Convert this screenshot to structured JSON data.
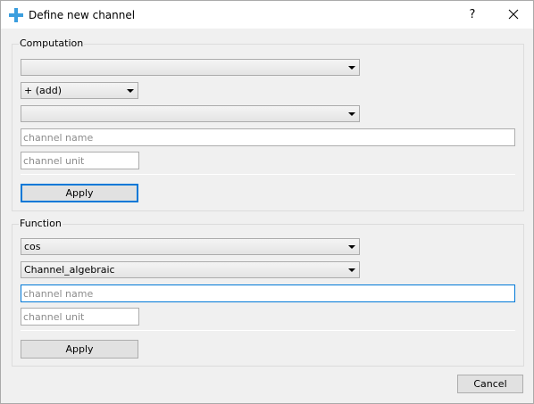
{
  "window": {
    "title": "Define new channel",
    "help_label": "?",
    "icons": {
      "app": "plus-icon",
      "close": "close-icon",
      "dropdown": "chevron-down-icon"
    }
  },
  "computation": {
    "title": "Computation",
    "operand1": "",
    "operator": "+ (add)",
    "operand2": "",
    "channel_name": {
      "value": "",
      "placeholder": "channel name"
    },
    "channel_unit": {
      "value": "",
      "placeholder": "channel unit"
    },
    "apply_label": "Apply"
  },
  "function": {
    "title": "Function",
    "function_name": "cos",
    "channel": "Channel_algebraic",
    "channel_name": {
      "value": "",
      "placeholder": "channel name"
    },
    "channel_unit": {
      "value": "",
      "placeholder": "channel unit"
    },
    "apply_label": "Apply"
  },
  "footer": {
    "cancel_label": "Cancel"
  },
  "colors": {
    "accent": "#0078d7",
    "app_icon": "#3b9ede"
  }
}
